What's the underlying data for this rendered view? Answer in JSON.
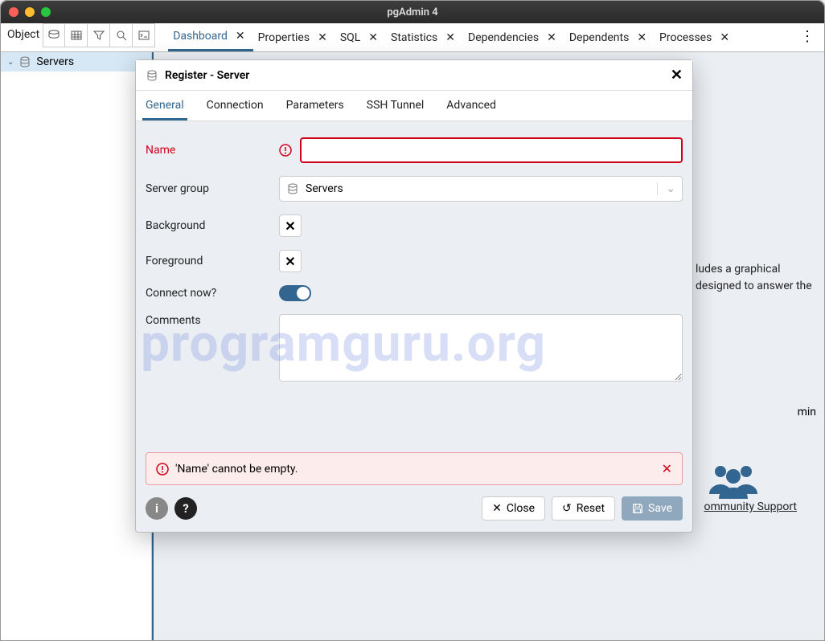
{
  "window": {
    "title": "pgAdmin 4"
  },
  "toolbar": {
    "object_label": "Object"
  },
  "tabs": [
    {
      "label": "Dashboard",
      "active": true
    },
    {
      "label": "Properties"
    },
    {
      "label": "SQL"
    },
    {
      "label": "Statistics"
    },
    {
      "label": "Dependencies"
    },
    {
      "label": "Dependents"
    },
    {
      "label": "Processes"
    }
  ],
  "tree": {
    "server_group": "Servers"
  },
  "background_snippets": {
    "line1": "ludes a graphical",
    "line2": "designed to answer the",
    "line3": "min",
    "community": "ommunity Support"
  },
  "modal": {
    "title": "Register - Server",
    "tabs": [
      {
        "label": "General",
        "active": true
      },
      {
        "label": "Connection"
      },
      {
        "label": "Parameters"
      },
      {
        "label": "SSH Tunnel"
      },
      {
        "label": "Advanced"
      }
    ],
    "fields": {
      "name": {
        "label": "Name",
        "value": "",
        "error": true
      },
      "server_group": {
        "label": "Server group",
        "value": "Servers"
      },
      "background": {
        "label": "Background"
      },
      "foreground": {
        "label": "Foreground"
      },
      "connect_now": {
        "label": "Connect now?",
        "value": true
      },
      "comments": {
        "label": "Comments",
        "value": ""
      }
    },
    "error_msg": "'Name' cannot be empty.",
    "buttons": {
      "close": "Close",
      "reset": "Reset",
      "save": "Save"
    }
  },
  "watermark": "programguru.org"
}
